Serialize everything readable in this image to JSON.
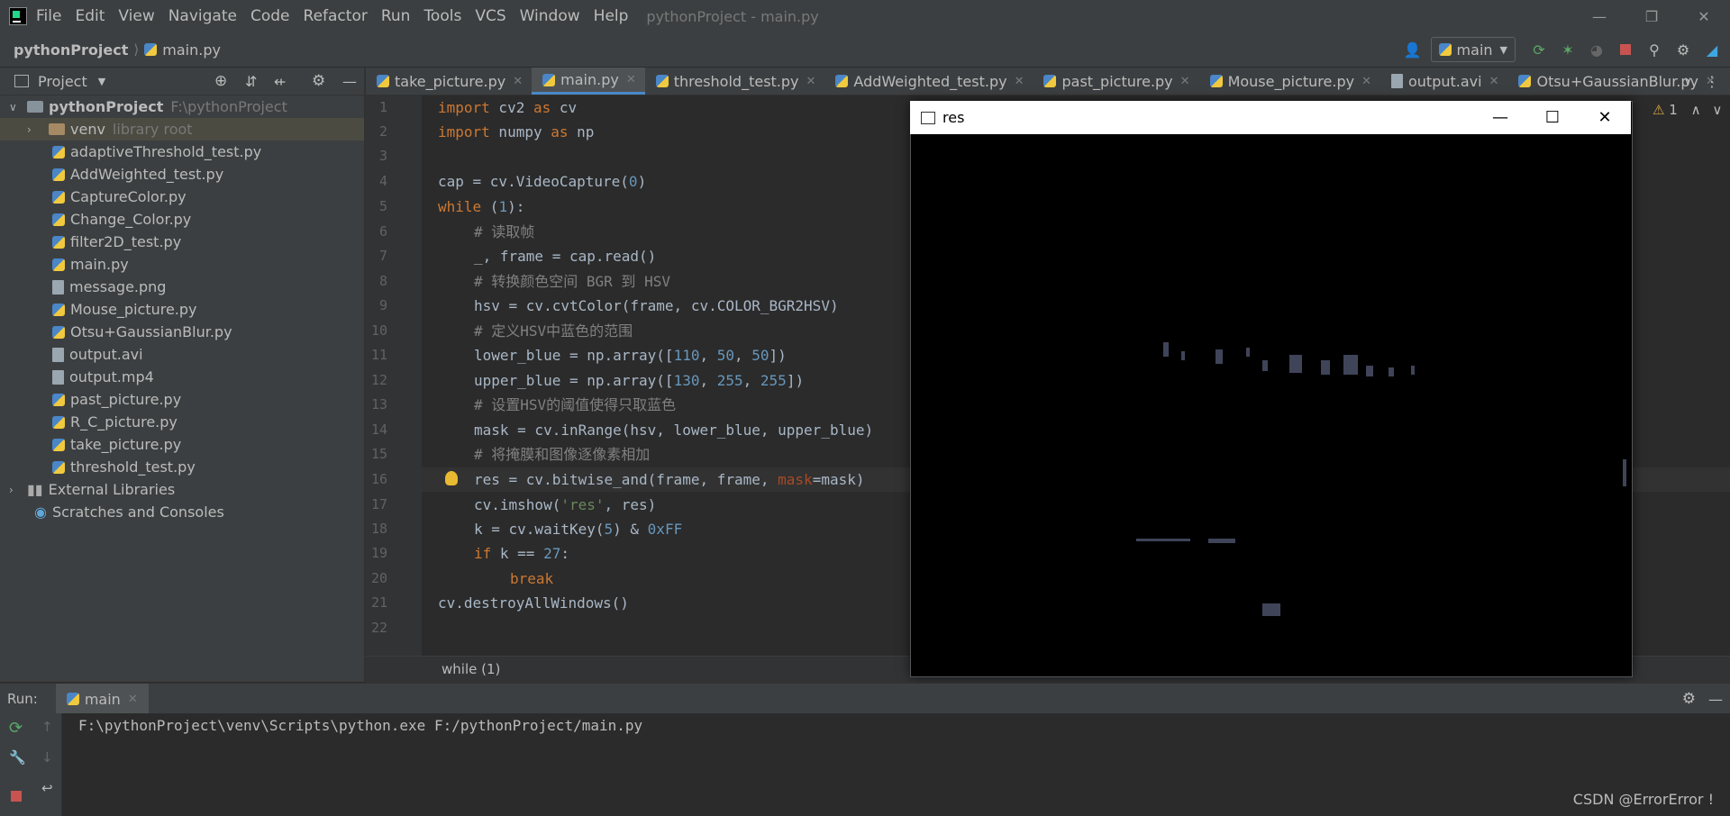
{
  "menubar": {
    "items": [
      "File",
      "Edit",
      "View",
      "Navigate",
      "Code",
      "Refactor",
      "Run",
      "Tools",
      "VCS",
      "Window",
      "Help"
    ],
    "window_title": "pythonProject - main.py"
  },
  "navbar": {
    "project": "pythonProject",
    "file": "main.py",
    "run_config": "main"
  },
  "project_panel": {
    "title": "Project",
    "root_name": "pythonProject",
    "root_path": "F:\\pythonProject",
    "venv_name": "venv",
    "venv_note": "library root",
    "files": [
      "adaptiveThreshold_test.py",
      "AddWeighted_test.py",
      "CaptureColor.py",
      "Change_Color.py",
      "filter2D_test.py",
      "main.py",
      "message.png",
      "Mouse_picture.py",
      "Otsu+GaussianBlur.py",
      "output.avi",
      "output.mp4",
      "past_picture.py",
      "R_C_picture.py",
      "take_picture.py",
      "threshold_test.py"
    ],
    "external_libraries": "External Libraries",
    "scratches": "Scratches and Consoles"
  },
  "tabs": [
    "take_picture.py",
    "main.py",
    "threshold_test.py",
    "AddWeighted_test.py",
    "past_picture.py",
    "Mouse_picture.py",
    "output.avi",
    "Otsu+GaussianBlur.py"
  ],
  "active_tab": "main.py",
  "editor": {
    "line_numbers": [
      "1",
      "2",
      "3",
      "4",
      "5",
      "6",
      "7",
      "8",
      "9",
      "10",
      "11",
      "12",
      "13",
      "14",
      "15",
      "16",
      "17",
      "18",
      "19",
      "20",
      "21",
      "22"
    ],
    "warning_count": "1",
    "breadcrumb": "while (1)"
  },
  "res_window": {
    "title": "res"
  },
  "run_panel": {
    "label": "Run:",
    "tab": "main",
    "command": "F:\\pythonProject\\venv\\Scripts\\python.exe F:/pythonProject/main.py"
  },
  "watermark": "CSDN @ErrorError !"
}
